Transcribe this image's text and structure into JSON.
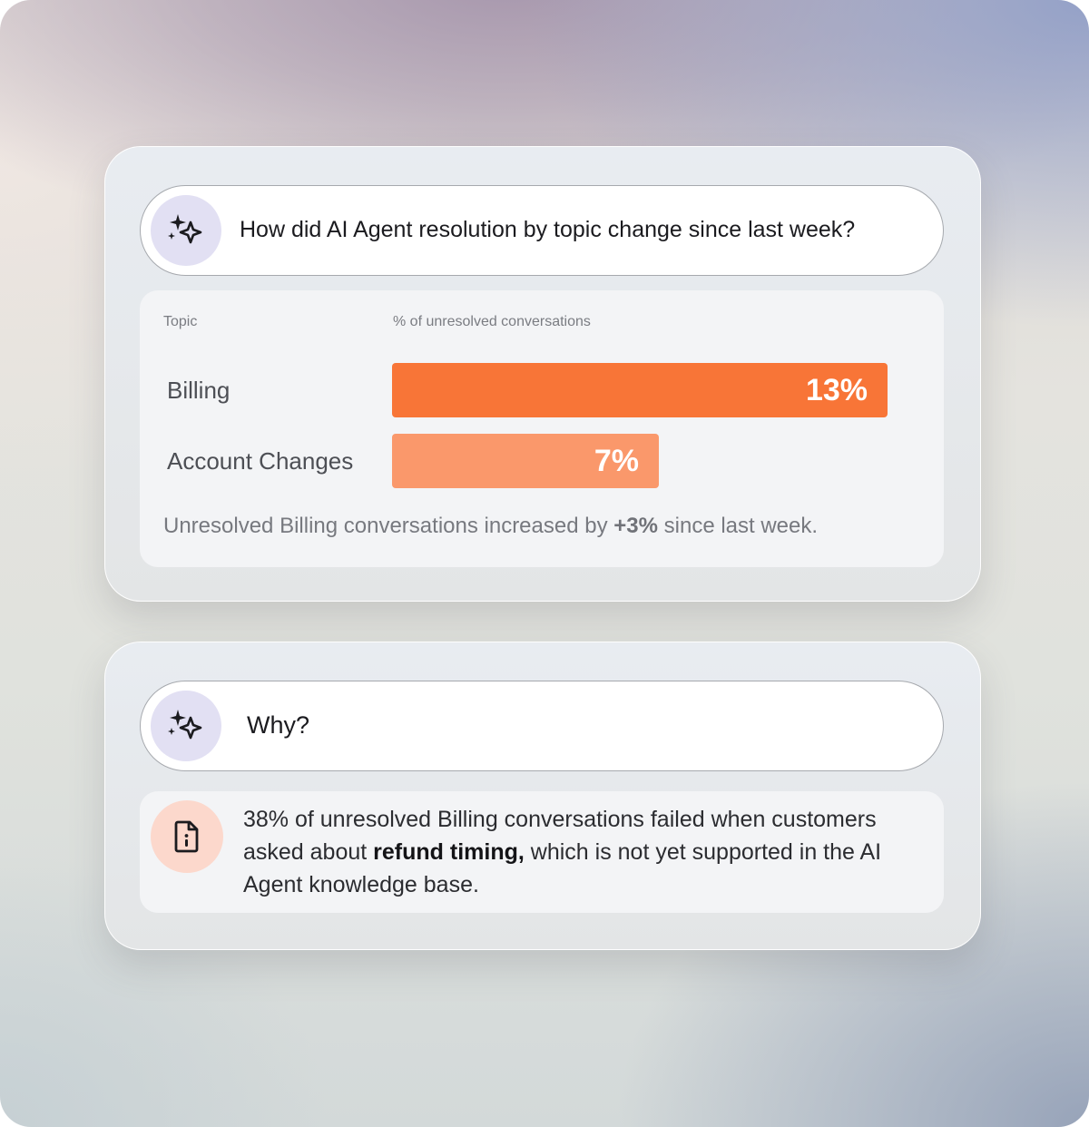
{
  "colors": {
    "accent_primary": "#f87537",
    "accent_secondary": "#fa986b",
    "sparkle_badge": "#e2e0f3",
    "info_badge": "#fcd8cc"
  },
  "icons": {
    "sparkle": "sparkle-icon",
    "document_info": "document-info-icon"
  },
  "question_card": {
    "prompt": "How did AI Agent resolution by topic change since last week?",
    "table": {
      "header_topic": "Topic",
      "header_metric": "% of unresolved conversations",
      "rows": [
        {
          "topic": "Billing",
          "value_label": "13%",
          "value": 13
        },
        {
          "topic": "Account Changes",
          "value_label": "7%",
          "value": 7
        }
      ],
      "scale_max": 13
    },
    "summary": {
      "prefix": "Unresolved Billing conversations increased by ",
      "highlight": "+3%",
      "suffix": " since last week."
    }
  },
  "followup_card": {
    "prompt": "Why?",
    "answer": {
      "part1": "38% of unresolved Billing conversations failed when customers asked about ",
      "highlight": "refund timing,",
      "part2": " which is not yet supported in the AI Agent knowledge base."
    }
  }
}
